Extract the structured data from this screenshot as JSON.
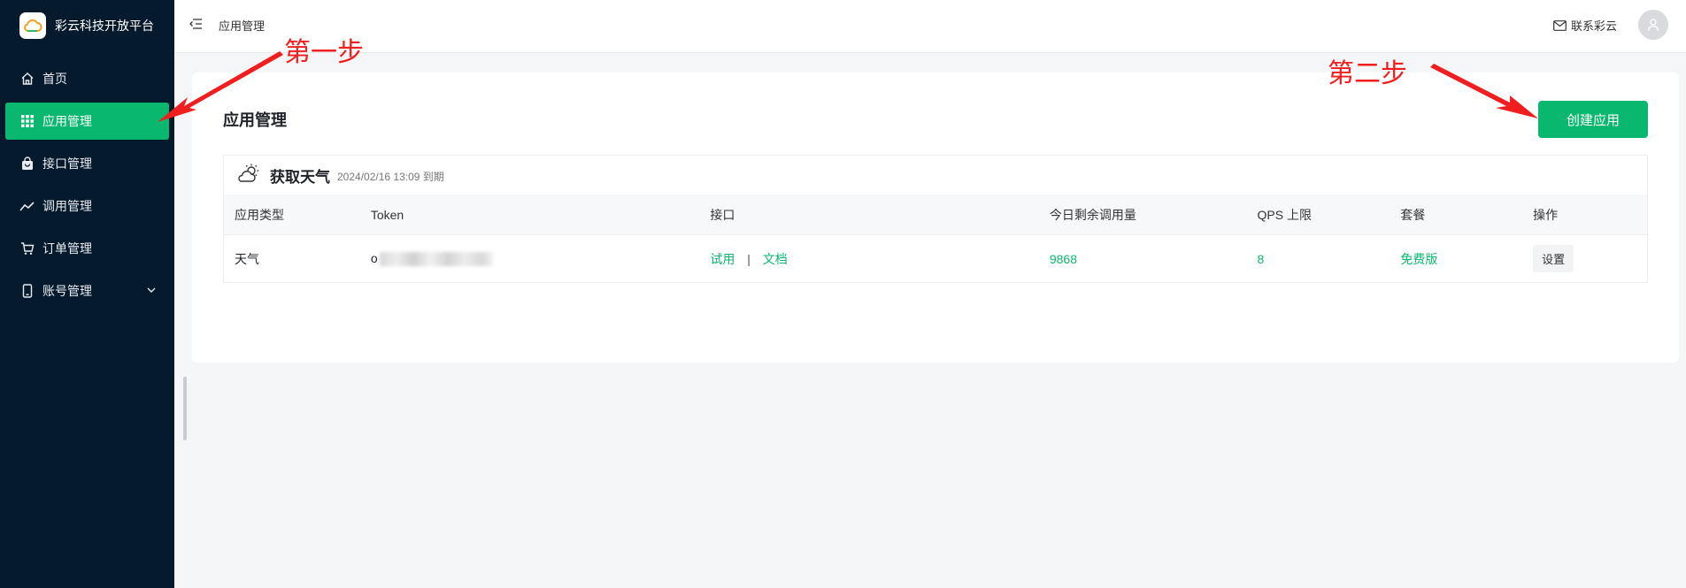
{
  "brand": {
    "name": "彩云科技开放平台"
  },
  "sidebar": {
    "items": [
      {
        "label": "首页",
        "icon": "home-icon"
      },
      {
        "label": "应用管理",
        "icon": "grid-icon",
        "active": true
      },
      {
        "label": "接口管理",
        "icon": "bag-icon"
      },
      {
        "label": "调用管理",
        "icon": "trend-icon"
      },
      {
        "label": "订单管理",
        "icon": "cart-icon"
      },
      {
        "label": "账号管理",
        "icon": "phone-icon",
        "expandable": true
      }
    ]
  },
  "header": {
    "breadcrumb": "应用管理",
    "contact_label": "联系彩云"
  },
  "main": {
    "title": "应用管理",
    "create_button": "创建应用",
    "app": {
      "name": "获取天气",
      "expire": "2024/02/16 13:09 到期",
      "columns": [
        "应用类型",
        "Token",
        "接口",
        "今日剩余调用量",
        "QPS 上限",
        "套餐",
        "操作"
      ],
      "row": {
        "type": "天气",
        "token_prefix": "o",
        "link_try": "试用",
        "link_separator": "|",
        "link_docs": "文档",
        "remaining": "9868",
        "qps": "8",
        "plan": "免费版",
        "action": "设置"
      }
    }
  },
  "annotations": {
    "step1": "第一步",
    "step2": "第二步"
  },
  "colors": {
    "sidebar_bg": "#061a2e",
    "accent": "#09b86e",
    "annotation": "#f01e1e"
  }
}
